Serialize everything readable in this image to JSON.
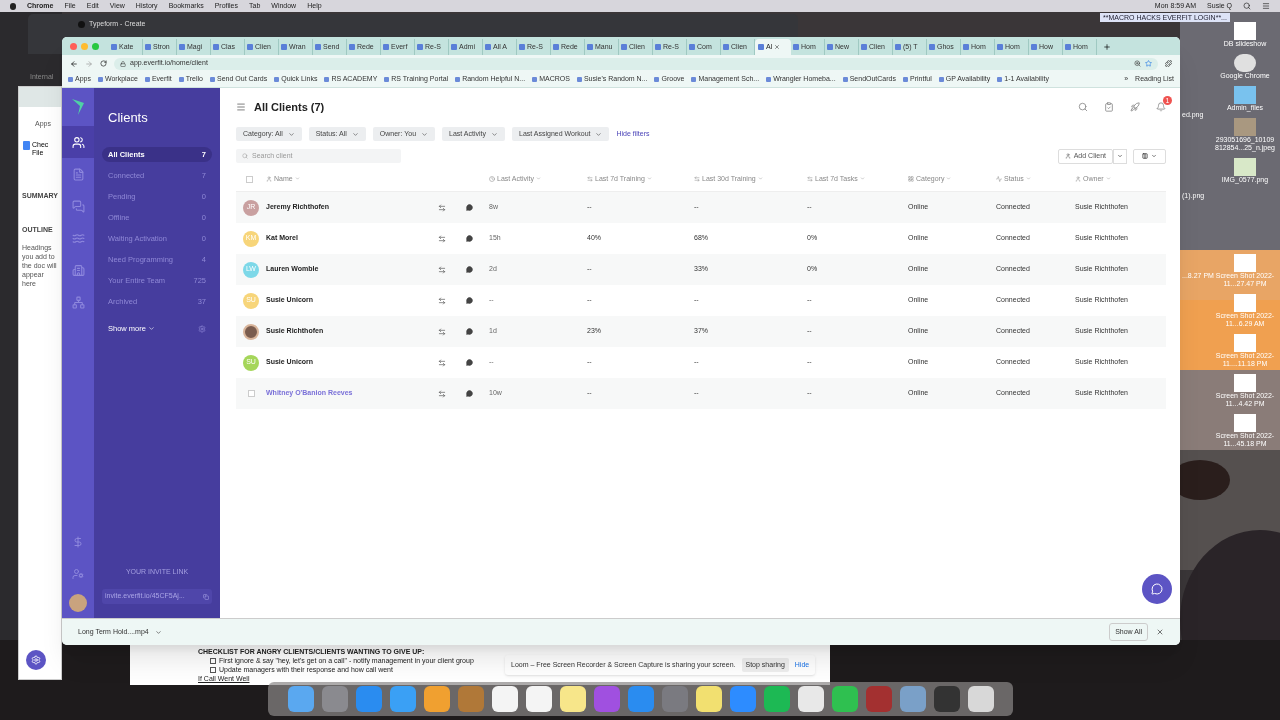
{
  "menubar": {
    "app": "Chrome",
    "menus": [
      "File",
      "Edit",
      "View",
      "History",
      "Bookmarks",
      "Profiles",
      "Tab",
      "Window",
      "Help"
    ],
    "clock": "Mon 8:59 AM",
    "user": "Susie Q"
  },
  "back_windows": {
    "typeform_tab": "Typeform - Create",
    "internal": "Internal",
    "apps": "Apps",
    "doc_title": "Chec",
    "doc_menu": "File",
    "summary": "SUMMARY",
    "outline": "OUTLINE",
    "outline_hint": "Headings you add to the doc will appear here",
    "banner": "**MACRO HACKS EVERFIT LOGIN**..."
  },
  "tabs": [
    {
      "label": "Kate",
      "selected": false
    },
    {
      "label": "Stron",
      "selected": false
    },
    {
      "label": "Magi",
      "selected": false
    },
    {
      "label": "Clas",
      "selected": false
    },
    {
      "label": "Clien",
      "selected": false
    },
    {
      "label": "Wran",
      "selected": false
    },
    {
      "label": "Send",
      "selected": false
    },
    {
      "label": "Rede",
      "selected": false
    },
    {
      "label": "Everf",
      "selected": false
    },
    {
      "label": "Re-S",
      "selected": false
    },
    {
      "label": "Admi",
      "selected": false
    },
    {
      "label": "All A",
      "selected": false
    },
    {
      "label": "Re-S",
      "selected": false
    },
    {
      "label": "Rede",
      "selected": false
    },
    {
      "label": "Manu",
      "selected": false
    },
    {
      "label": "Clien",
      "selected": false
    },
    {
      "label": "Re-S",
      "selected": false
    },
    {
      "label": "Com",
      "selected": false
    },
    {
      "label": "Clien",
      "selected": false
    },
    {
      "label": "Al",
      "selected": true
    },
    {
      "label": "Hom",
      "selected": false
    },
    {
      "label": "New",
      "selected": false
    },
    {
      "label": "Clien",
      "selected": false
    },
    {
      "label": "(5) T",
      "selected": false
    },
    {
      "label": "Ghos",
      "selected": false
    },
    {
      "label": "Hom",
      "selected": false
    },
    {
      "label": "Hom",
      "selected": false
    },
    {
      "label": "How",
      "selected": false
    },
    {
      "label": "Hom",
      "selected": false
    }
  ],
  "address": "app.everfit.io/home/client",
  "bookmarks": [
    "Apps",
    "Workplace",
    "Everfit",
    "Trello",
    "Send Out Cards",
    "Quick Links",
    "RS ACADEMY",
    "RS Training Portal",
    "Random Helpful N...",
    "MACROS",
    "Susie's Random N...",
    "Groove",
    "Management Sch...",
    "Wrangler Homeba...",
    "SendOutCards",
    "Printful",
    "GP Availability",
    "1-1 Availability"
  ],
  "bookmarks_more": "»",
  "reading_list": "Reading List",
  "sidebar": {
    "title": "Clients",
    "items": [
      {
        "label": "All Clients",
        "count": "7",
        "selected": true
      },
      {
        "label": "Connected",
        "count": "7",
        "selected": false
      },
      {
        "label": "Pending",
        "count": "0",
        "selected": false
      },
      {
        "label": "Offline",
        "count": "0",
        "selected": false
      },
      {
        "label": "Waiting Activation",
        "count": "0",
        "selected": false
      },
      {
        "label": "Need Programming",
        "count": "4",
        "selected": false
      },
      {
        "label": "Your Entire Team",
        "count": "725",
        "selected": false
      },
      {
        "label": "Archived",
        "count": "37",
        "selected": false
      }
    ],
    "show_more": "Show more",
    "invite_heading": "YOUR INVITE LINK",
    "invite_link": "invite.everfit.io/45CF5Aj..."
  },
  "header": {
    "title": "All Clients (7)",
    "notification_count": "1"
  },
  "filters": [
    {
      "label": "Category: All"
    },
    {
      "label": "Status: All"
    },
    {
      "label": "Owner: You"
    },
    {
      "label": "Last Activity"
    },
    {
      "label": "Last Assigned Workout"
    }
  ],
  "hide_filters": "Hide filters",
  "search": {
    "placeholder": "Search client"
  },
  "add_client": "Add Client",
  "table": {
    "select_all_checked": false,
    "columns": [
      "Name",
      "Last Activity",
      "Last 7d Training",
      "Last 30d Training",
      "Last 7d Tasks",
      "Category",
      "Status",
      "Owner"
    ],
    "rows": [
      {
        "kind": "initials",
        "initials": "JR",
        "color": "#c9a0a0",
        "cells": [
          "Jeremy Richthofen",
          "8w",
          "--",
          "--",
          "--",
          "Online",
          "Connected",
          "Susie Richthofen"
        ]
      },
      {
        "kind": "initials",
        "initials": "KM",
        "color": "#f7d57a",
        "cells": [
          "Kat Morel",
          "15h",
          "40%",
          "68%",
          "0%",
          "Online",
          "Connected",
          "Susie Richthofen"
        ]
      },
      {
        "kind": "initials",
        "initials": "LW",
        "color": "#7dd8e8",
        "cells": [
          "Lauren Womble",
          "2d",
          "--",
          "33%",
          "0%",
          "Online",
          "Connected",
          "Susie Richthofen"
        ]
      },
      {
        "kind": "initials",
        "initials": "SU",
        "color": "#f7d57a",
        "cells": [
          "Susie Unicorn",
          "--",
          "--",
          "--",
          "--",
          "Online",
          "Connected",
          "Susie Richthofen"
        ]
      },
      {
        "cells": [
          "Susie Richthofen",
          "1d",
          "23%",
          "37%",
          "--",
          "Online",
          "Connected",
          "Susie Richthofen"
        ]
      },
      {
        "kind": "initials",
        "initials": "SU",
        "color": "#a5d65a",
        "cells": [
          "Susie Unicorn",
          "--",
          "--",
          "--",
          "--",
          "Online",
          "Connected",
          "Susie Richthofen"
        ]
      },
      {
        "kind": "checkbox",
        "checked": false,
        "cells": [
          "Whitney O'Banion Reeves",
          "10w",
          "--",
          "--",
          "--",
          "Online",
          "Connected",
          "Susie Richthofen"
        ]
      }
    ]
  },
  "downloads": {
    "file": "Long Term Hold....mp4",
    "show_all": "Show All"
  },
  "sheet": {
    "heading": "CHECKLIST FOR ANGRY CLIENTS/CLIENTS WANTING TO GIVE UP:",
    "items": [
      {
        "text": "First ignore & say \"hey, let's get on a call\" - notify management in your client group",
        "checked": false
      },
      {
        "text": "Update managers with their response and how call went",
        "checked": false
      }
    ],
    "link": "If Call Went Well"
  },
  "loom": {
    "message": "Loom – Free Screen Recorder & Screen Capture is sharing your screen.",
    "stop": "Stop sharing",
    "hide": "Hide"
  },
  "desktop_icons": [
    {
      "label": "DB slideshow",
      "kind": "screenshot"
    },
    {
      "label": "Google Chrome",
      "kind": "app"
    },
    {
      "label": "Admin_files",
      "kind": "folder"
    },
    {
      "label": "293051696_10109 812854...25_n.jpeg"
    },
    {
      "label": "IMG_0577.png",
      "kind": "poster"
    },
    {
      "label": "Screen Shot 2022-11...27.47 PM",
      "kind": "screenshot"
    },
    {
      "label": "Screen Shot 2022-11...6.29 AM",
      "kind": "screenshot"
    },
    {
      "label": "Screen Shot 2022-11....11.18 PM",
      "kind": "screenshot"
    },
    {
      "label": "Screen Shot 2022-11...4.42 PM",
      "kind": "screenshot"
    },
    {
      "label": "Screen Shot 2022-11...45.18 PM",
      "kind": "screenshot"
    }
  ],
  "desktop_partial": [
    "ed.png",
    "(1).png",
    "...8.27 PM"
  ]
}
